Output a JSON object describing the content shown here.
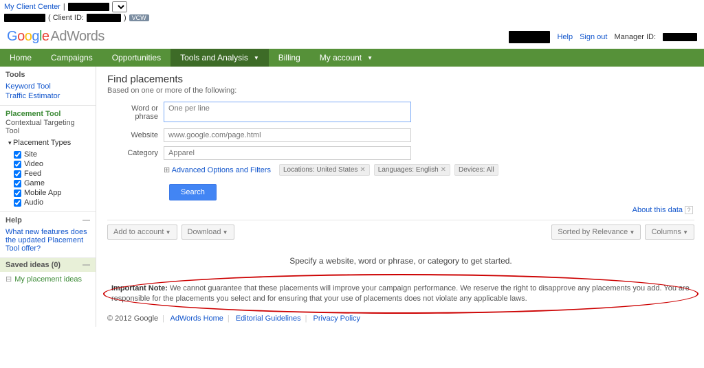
{
  "top": {
    "client_center": "My Client Center",
    "client_id_label": "( Client ID:",
    "vcw": "VCW"
  },
  "brand": {
    "adwords": "AdWords",
    "help": "Help",
    "signout": "Sign out",
    "manager": "Manager ID:"
  },
  "nav": [
    "Home",
    "Campaigns",
    "Opportunities",
    "Tools and Analysis",
    "Billing",
    "My account"
  ],
  "side": {
    "tools": "Tools",
    "keyword": "Keyword Tool",
    "traffic": "Traffic Estimator",
    "placement": "Placement Tool",
    "contextual": "Contextual Targeting Tool",
    "types": "Placement Types",
    "chk": [
      "Site",
      "Video",
      "Feed",
      "Game",
      "Mobile App",
      "Audio"
    ],
    "help": "Help",
    "helpq": "What new features does the updated Placement Tool offer?",
    "saved": "Saved ideas (0)",
    "mypl": "My placement ideas"
  },
  "main": {
    "title": "Find placements",
    "sub": "Based on one or more of the following:",
    "word": "Word or phrase",
    "word_ph": "One per line",
    "website": "Website",
    "website_ph": "www.google.com/page.html",
    "category": "Category",
    "category_ph": "Apparel",
    "adv": "Advanced Options and Filters",
    "tag_loc": "Locations: United States",
    "tag_lang": "Languages: English",
    "tag_dev": "Devices: All",
    "search": "Search",
    "about": "About this data",
    "add": "Add to account",
    "download": "Download",
    "sorted": "Sorted by Relevance",
    "columns": "Columns",
    "prompt": "Specify a website, word or phrase, or category to get started.",
    "note_b": "Important Note:",
    "note": " We cannot guarantee that these placements will improve your campaign performance. We reserve the right to disapprove any placements you add. You are responsible for the placements you select and for ensuring that your use of placements does not violate any applicable laws."
  },
  "footer": {
    "copy": "© 2012 Google",
    "home": "AdWords Home",
    "guide": "Editorial Guidelines",
    "priv": "Privacy Policy"
  }
}
